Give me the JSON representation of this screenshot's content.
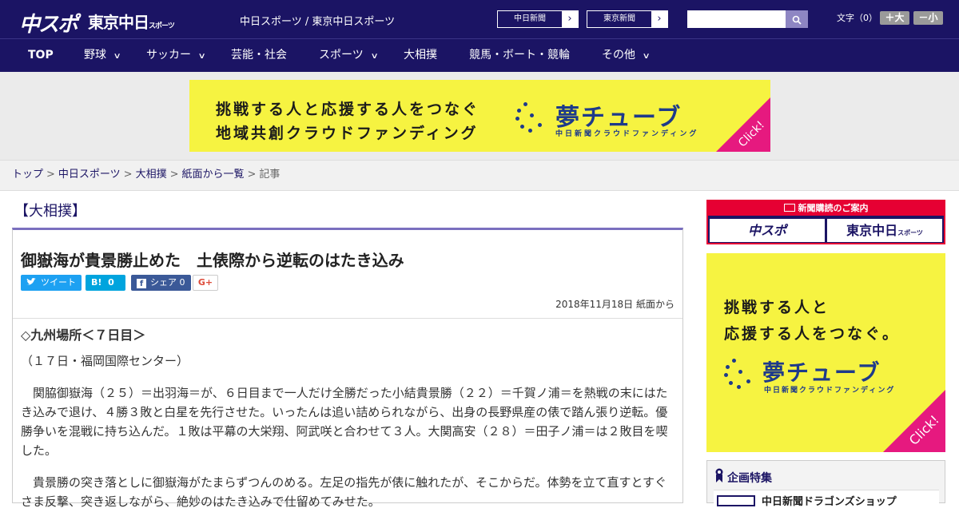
{
  "header": {
    "logo_main": "中スポ",
    "logo_tokyo": "東京中日",
    "logo_tokyo_small": "スポーツ",
    "site_title": "中日スポーツ / 東京中日スポーツ",
    "ext_links": [
      "中日新聞",
      "東京新聞"
    ],
    "ext_arrow": "›",
    "search_placeholder": "",
    "fontsize_label": "文字（0）",
    "font_plus": "＋大",
    "font_minus": "－小"
  },
  "nav": {
    "items": [
      {
        "label": "TOP",
        "has_menu": false
      },
      {
        "label": "野球",
        "has_menu": true
      },
      {
        "label": "サッカー",
        "has_menu": true
      },
      {
        "label": "芸能・社会",
        "has_menu": false
      },
      {
        "label": "スポーツ",
        "has_menu": true
      },
      {
        "label": "大相撲",
        "has_menu": false
      },
      {
        "label": "競馬・ボート・競輪",
        "has_menu": false
      },
      {
        "label": "その他",
        "has_menu": true
      }
    ],
    "chevron": "∨"
  },
  "ad_banner": {
    "line1": "挑戦する人と応援する人をつなぐ",
    "line2": "地域共創クラウドファンディング",
    "brand": "夢チューブ",
    "brand_sub": "中日新聞クラウドファンディング",
    "click": "Click!",
    "bg_color": "#f6f341",
    "corner_color": "#e6197f"
  },
  "breadcrumb": {
    "items": [
      "トップ",
      "中日スポーツ",
      "大相撲",
      "紙面から一覧"
    ],
    "current": "記事",
    "separator": ">"
  },
  "article": {
    "category": "【大相撲】",
    "headline": "御嶽海が貴景勝止めた　土俵際から逆転のはたき込み",
    "share": {
      "tweet": "ツイート",
      "hatena": "B!",
      "hatena_count": "0",
      "facebook": "シェア",
      "facebook_count": "0",
      "gplus": "G+"
    },
    "date": "2018年11月18日 紙面から",
    "subhead": "◇九州場所＜７日目＞",
    "venue": "（１７日・福岡国際センター）",
    "para1": "関脇御嶽海（２５）＝出羽海＝が、６日目まで一人だけ全勝だった小結貴景勝（２２）＝千賀ノ浦＝を熱戦の末にはたき込みで退け、４勝３敗と白星を先行させた。いったんは追い詰められながら、出身の長野県産の俵で踏ん張り逆転。優勝争いを混戦に持ち込んだ。１敗は平幕の大栄翔、阿武咲と合わせて３人。大関高安（２８）＝田子ノ浦＝は２敗目を喫した。",
    "para2": "貴景勝の突き落としに御嶽海がたまらずつんのめる。左足の指先が俵に触れたが、そこからだ。体勢を立て直すとすぐさま反撃、突き返しながら、絶妙のはたき込みで仕留めてみせた。"
  },
  "sidebar": {
    "subscribe_title": "新聞購読のご案内",
    "subscribe_left": "中スポ",
    "subscribe_right": "東京中日",
    "subscribe_right_small": "スポーツ",
    "banner_line1": "挑戦する人と",
    "banner_line2": "応援する人をつなぐ。",
    "banner_brand": "夢チューブ",
    "banner_sub": "中日新聞クラウドファンディング",
    "banner_click": "Click!",
    "feature_title": "企画特集",
    "feature_item": "中日新聞ドラゴンズショップ"
  },
  "colors": {
    "brand_navy": "#1b1464",
    "accent_purple": "#7a6fbf",
    "subscribe_red": "#e60033",
    "twitter": "#1da1f2",
    "hatena": "#00a4de",
    "facebook": "#3b5998"
  }
}
